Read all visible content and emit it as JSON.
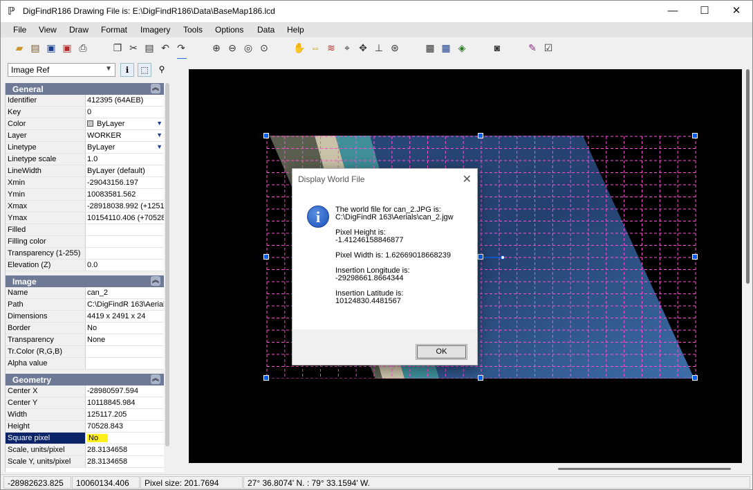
{
  "window": {
    "title": "DigFindR186 Drawing File is: E:\\DigFindR186\\Data\\BaseMap186.lcd",
    "app_icon": "ℙ",
    "minimize": "—",
    "maximize": "☐",
    "close": "✕"
  },
  "menu": [
    "File",
    "View",
    "Draw",
    "Format",
    "Imagery",
    "Tools",
    "Options",
    "Data",
    "Help"
  ],
  "toolbar_icons": [
    "open-folder-icon",
    "import-icon",
    "save-icon",
    "save-as-icon",
    "print-icon",
    "copy-icon",
    "cut-icon",
    "paste-icon",
    "undo-icon",
    "redo-icon",
    "zoom-window-icon",
    "zoom-out-icon",
    "zoom-previous-icon",
    "zoom-in-icon",
    "pan-hand-icon",
    "measure-icon",
    "layers-icon",
    "snap-icon",
    "move-icon",
    "axis-icon",
    "compass-icon",
    "properties-icon",
    "table-icon",
    "database-icon",
    "camera-icon",
    "pen-icon",
    "checklist-icon"
  ],
  "panel": {
    "object_select": "Image Ref",
    "sections": [
      {
        "title": "General",
        "rows": [
          {
            "key": "Identifier",
            "value": "412395 (64AEB)"
          },
          {
            "key": "Key",
            "value": "0"
          },
          {
            "key": "Color",
            "value": "ByLayer",
            "swatch": "#c8c8c8",
            "dropdown": true
          },
          {
            "key": "Layer",
            "value": "WORKER",
            "dropdown": true
          },
          {
            "key": "Linetype",
            "value": "ByLayer",
            "dropdown": true
          },
          {
            "key": "Linetype scale",
            "value": "1.0"
          },
          {
            "key": "LineWidth",
            "value": "ByLayer (default)"
          },
          {
            "key": "Xmin",
            "value": "-29043156.197"
          },
          {
            "key": "Ymin",
            "value": "10083581.562"
          },
          {
            "key": "Xmax",
            "value": "-28918038.992  (+1251"
          },
          {
            "key": "Ymax",
            "value": "10154110.406  (+70528"
          },
          {
            "key": "Filled",
            "value": ""
          },
          {
            "key": "Filling color",
            "value": ""
          },
          {
            "key": "Transparency (1-255)",
            "value": ""
          },
          {
            "key": "Elevation (Z)",
            "value": "0.0"
          }
        ]
      },
      {
        "title": "Image",
        "rows": [
          {
            "key": "Name",
            "value": "can_2"
          },
          {
            "key": "Path",
            "value": "C:\\DigFindR 163\\Aerial"
          },
          {
            "key": "Dimensions",
            "value": "4419 x 2491 x 24"
          },
          {
            "key": "Border",
            "value": "No"
          },
          {
            "key": "Transparency",
            "value": "None"
          },
          {
            "key": "Tr.Color (R,G,B)",
            "value": ""
          },
          {
            "key": "Alpha value",
            "value": ""
          }
        ]
      },
      {
        "title": "Geometry",
        "rows": [
          {
            "key": "Center X",
            "value": "-28980597.594"
          },
          {
            "key": "Center Y",
            "value": "10118845.984"
          },
          {
            "key": "Width",
            "value": "125117.205"
          },
          {
            "key": "Height",
            "value": "70528.843"
          },
          {
            "key": "Square pixel",
            "value": "No",
            "selected": true
          },
          {
            "key": "Scale, units/pixel",
            "value": "28.3134658"
          },
          {
            "key": "Scale Y, units/pixel",
            "value": "28.3134658"
          }
        ]
      }
    ]
  },
  "dialog": {
    "title": "Display World File",
    "close": "✕",
    "icon": "i",
    "message": "The world file for can_2.JPG is:\nC:\\DigFindR 163\\Aerials\\can_2.jgw\n\nPixel Height is:\n-1.41246158846877\n\nPixel Width is: 1.62669018668239\n\nInsertion Longitude is:\n-29298661.8664344\n\nInsertion Latitude is:\n10124830.4481567",
    "ok": "OK"
  },
  "status": [
    "-28982623.825",
    "10060134.406",
    "Pixel size: 201.7694",
    "27° 36.8074' N.   :   79° 33.1594' W."
  ],
  "colors": {
    "accent": "#0a5ee8",
    "section_header": "#6e7a95",
    "grid_line": "#ff4fd8",
    "highlight": "#ffef1f",
    "selection": "#0a246a"
  }
}
